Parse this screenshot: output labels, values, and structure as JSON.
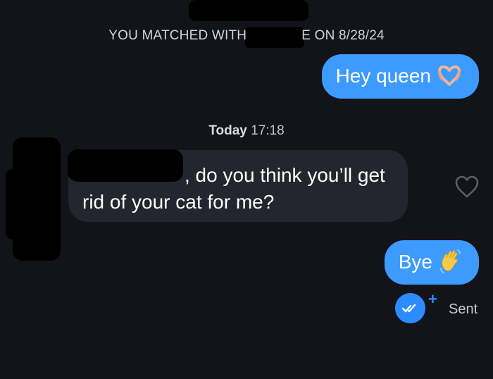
{
  "match_banner": {
    "prefix": "YOU MATCHED WITH",
    "suffix": "E ON 8/28/24"
  },
  "messages": {
    "hey": {
      "text": "Hey queen",
      "emoji": "heart-hands-emoji"
    },
    "incoming": {
      "line1": ", do you think you’ll get",
      "line2": "rid of your cat for me?"
    },
    "bye": {
      "text": "Bye",
      "emoji": "waving-hand-emoji"
    }
  },
  "timestamp": {
    "day": "Today",
    "time": "17:18"
  },
  "status": {
    "plus": "+",
    "label": "Sent"
  },
  "colors": {
    "background": "#121419",
    "outgoing_bubble": "#3d9bff",
    "incoming_bubble": "#23262e",
    "accent": "#2c8cff"
  }
}
